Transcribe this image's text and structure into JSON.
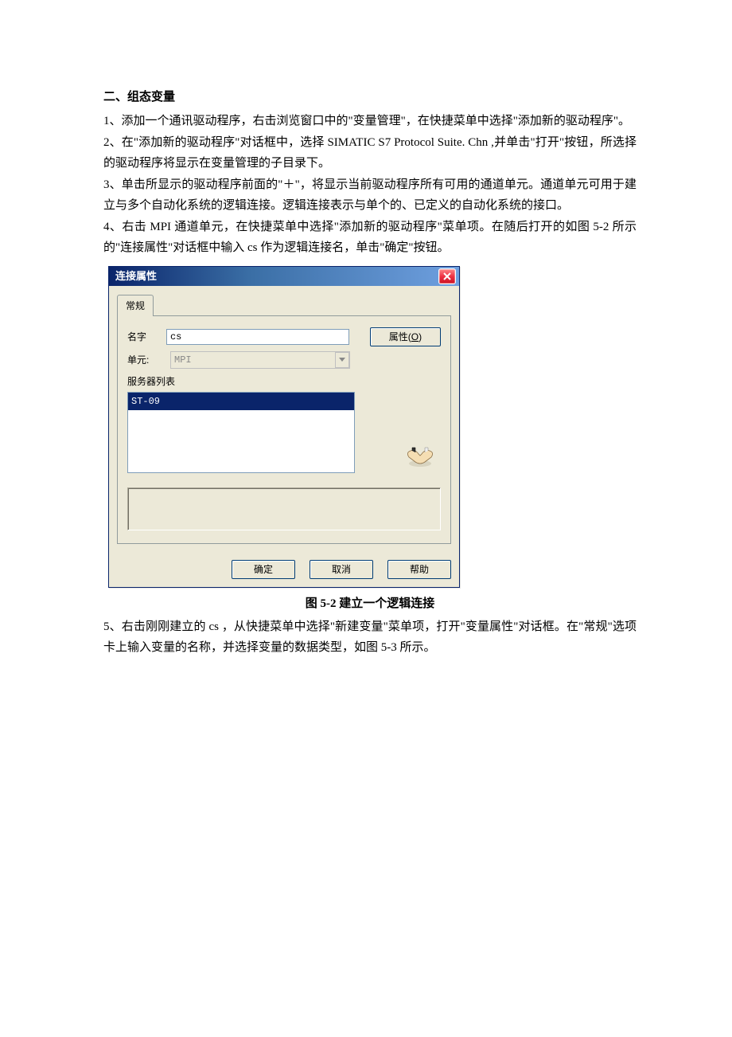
{
  "doc": {
    "heading": "二、组态变量",
    "p1": "1、添加一个通讯驱动程序，右击浏览窗口中的\"变量管理\"，在快捷菜单中选择\"添加新的驱动程序\"。",
    "p2": "2、在\"添加新的驱动程序\"对话框中，选择 SIMATIC S7 Protocol Suite. Chn ,并单击\"打开\"按钮，所选择的驱动程序将显示在变量管理的子目录下。",
    "p3": "3、单击所显示的驱动程序前面的\"＋\"，将显示当前驱动程序所有可用的通道单元。通道单元可用于建立与多个自动化系统的逻辑连接。逻辑连接表示与单个的、已定义的自动化系统的接口。",
    "p4": "4、右击 MPI 通道单元，在快捷菜单中选择\"添加新的驱动程序\"菜单项。在随后打开的如图 5-2 所示的\"连接属性\"对话框中输入 cs 作为逻辑连接名，单击\"确定\"按钮。",
    "figcaption": "图 5-2  建立一个逻辑连接",
    "p5": "5、右击刚刚建立的 cs  ，从快捷菜单中选择\"新建变量\"菜单项，打开\"变量属性\"对话框。在\"常规\"选项卡上输入变量的名称，并选择变量的数据类型，如图 5-3 所示。"
  },
  "dialog": {
    "title": "连接属性",
    "tab": "常规",
    "name_label": "名字",
    "name_value": "cs",
    "unit_label": "单元:",
    "unit_value": "MPI",
    "props_button_prefix": "属性(",
    "props_button_key": "O",
    "props_button_suffix": ")",
    "server_list_label": "服务器列表",
    "server_item": "ST-09",
    "ok": "确定",
    "cancel": "取消",
    "help": "帮助"
  }
}
